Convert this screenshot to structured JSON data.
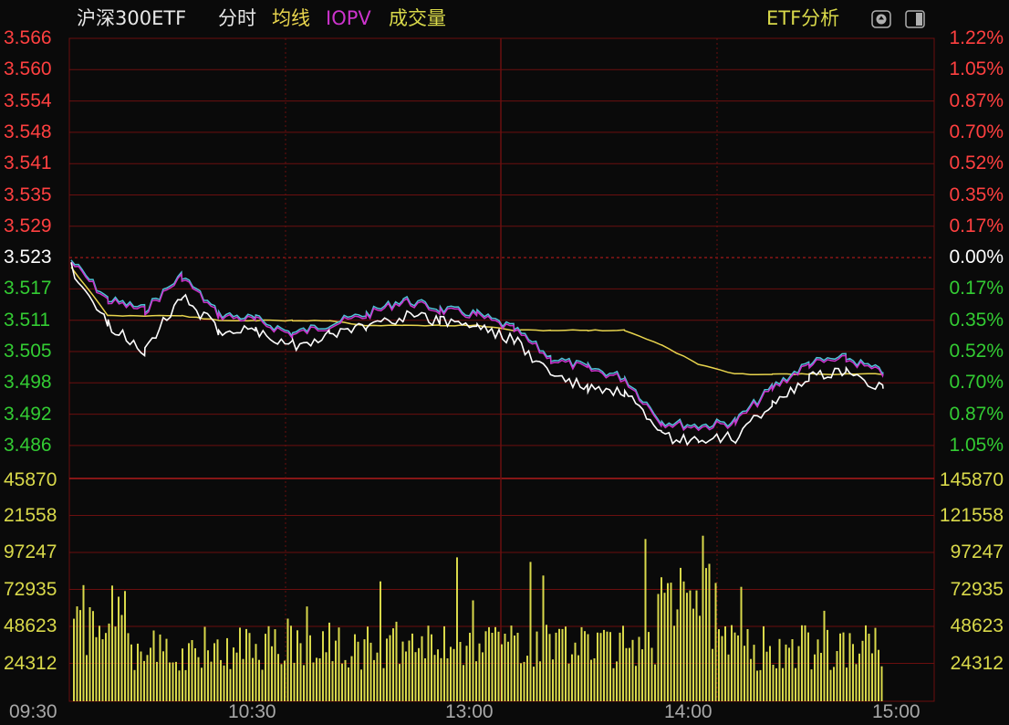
{
  "header": {
    "title": "沪深300ETF",
    "period": "分时",
    "legend_avg": "均线",
    "legend_iopv": "IOPV",
    "legend_volume": "成交量",
    "analysis_button": "ETF分析"
  },
  "colors": {
    "up": "#ff4040",
    "down": "#33cc33",
    "neutral": "#ffffff",
    "grid": "#6b0f0f",
    "price_line": "#ffffff",
    "avg_line": "#e8d44d",
    "iopv_line": "#cc33cc",
    "volume_bar": "#d9d94a",
    "volume_label": "#d9d94a",
    "cyan_line": "#4fc3d8"
  },
  "icons": [
    "zoom-icon",
    "panel-toggle-icon"
  ],
  "price_axis": {
    "left": [
      "3.566",
      "3.560",
      "3.554",
      "3.548",
      "3.541",
      "3.535",
      "3.529",
      "3.523",
      "3.517",
      "3.511",
      "3.505",
      "3.498",
      "3.492",
      "3.486"
    ],
    "right": [
      "1.22%",
      "1.05%",
      "0.87%",
      "0.70%",
      "0.52%",
      "0.35%",
      "0.17%",
      "0.00%",
      "0.17%",
      "0.35%",
      "0.52%",
      "0.70%",
      "0.87%",
      "1.05%"
    ]
  },
  "volume_axis": {
    "left": [
      "45870",
      "21558",
      "97247",
      "72935",
      "48623",
      "24312"
    ],
    "right": [
      "145870",
      "121558",
      "97247",
      "72935",
      "48623",
      "24312"
    ]
  },
  "time_axis": [
    "09:30",
    "10:30",
    "13:00",
    "14:00",
    "15:00"
  ],
  "chart_data": {
    "type": "line",
    "prev_close": 3.523,
    "ylim": [
      3.483,
      3.569
    ],
    "x": [
      "09:30",
      "10:30",
      "13:00",
      "14:00",
      "15:00"
    ],
    "series": [
      {
        "name": "IOPV",
        "values": [
          3.523,
          3.515,
          3.513,
          3.52,
          3.512,
          3.511,
          3.508,
          3.51,
          3.512,
          3.515,
          3.513,
          3.512,
          3.509,
          3.503,
          3.501,
          3.499,
          3.49,
          3.489,
          3.49,
          3.497,
          3.502,
          3.503,
          3.5
        ]
      },
      {
        "name": "均线",
        "values": [
          3.522,
          3.512,
          3.512,
          3.512,
          3.511,
          3.511,
          3.511,
          3.511,
          3.51,
          3.51,
          3.51,
          3.51,
          3.509,
          3.509,
          3.509,
          3.509,
          3.506,
          3.502,
          3.5,
          3.5,
          3.5,
          3.5,
          3.5
        ]
      },
      {
        "values": [
          3.522,
          3.51,
          3.505,
          3.516,
          3.509,
          3.509,
          3.506,
          3.508,
          3.51,
          3.512,
          3.511,
          3.51,
          3.507,
          3.5,
          3.497,
          3.496,
          3.487,
          3.486,
          3.487,
          3.494,
          3.499,
          3.501,
          3.497
        ]
      }
    ],
    "volume": {
      "max": 145870,
      "ticks": [
        24312,
        48623,
        72935,
        97247,
        121558,
        145870
      ]
    }
  }
}
